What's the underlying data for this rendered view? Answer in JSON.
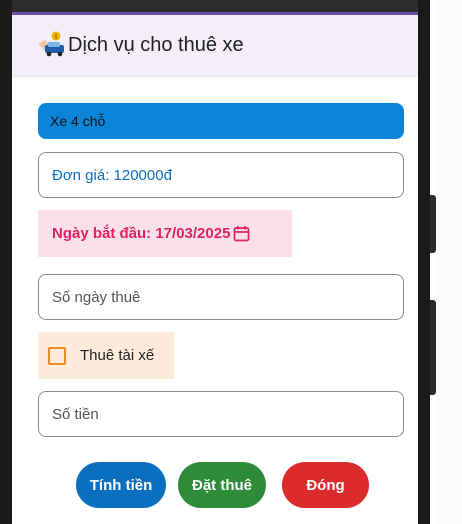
{
  "app": {
    "title": "Dịch vụ cho thuê xe"
  },
  "form": {
    "car_type": "Xe 4 chỗ",
    "price": "Đơn giá: 120000đ",
    "start_date": "Ngày bắt đầu: 17/03/2025",
    "days_placeholder": "Số ngày thuê",
    "driver_label": "Thuê tài xế",
    "driver_checked": false,
    "amount_placeholder": "Số tiền"
  },
  "buttons": {
    "calculate": "Tính tiền",
    "book": "Đặt thuê",
    "close": "Đóng"
  },
  "colors": {
    "appbar": "#f3eef8",
    "select": "#0b84d8",
    "date_text": "#e0216a",
    "date_bg": "#fbe0e7",
    "driver_bg": "#fdebdc",
    "checkbox": "#f08a24",
    "calculate": "#0b6fbf",
    "book": "#2e8b3a",
    "close": "#dc2b2b"
  },
  "icons": {
    "app": "car-rental-icon",
    "date": "calendar-icon"
  }
}
